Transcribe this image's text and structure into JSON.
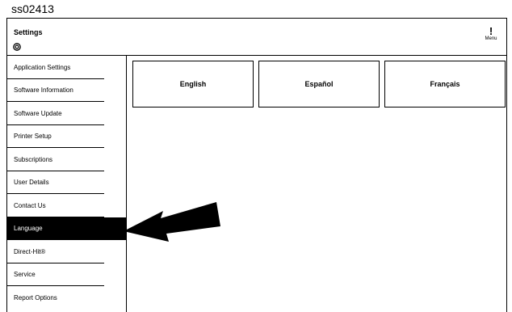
{
  "figure_id": "ss02413",
  "header": {
    "title": "Settings",
    "menu_label": "Menu",
    "menu_glyph": "!"
  },
  "icons": {
    "settings": "settings-circle-icon",
    "menu": "menu-exclamation-icon",
    "callout": "arrow-callout-icon"
  },
  "sidebar": {
    "items": [
      {
        "label": "Application Settings",
        "active": false
      },
      {
        "label": "Software Information",
        "active": false
      },
      {
        "label": "Software Update",
        "active": false
      },
      {
        "label": "Printer Setup",
        "active": false
      },
      {
        "label": "Subscriptions",
        "active": false
      },
      {
        "label": "User Details",
        "active": false
      },
      {
        "label": "Contact Us",
        "active": false
      },
      {
        "label": "Language",
        "active": true
      },
      {
        "label": "Direct-Hit®",
        "active": false
      },
      {
        "label": "Service",
        "active": false
      },
      {
        "label": "Report Options",
        "active": false
      }
    ]
  },
  "languages": [
    "English",
    "Español",
    "Français"
  ]
}
